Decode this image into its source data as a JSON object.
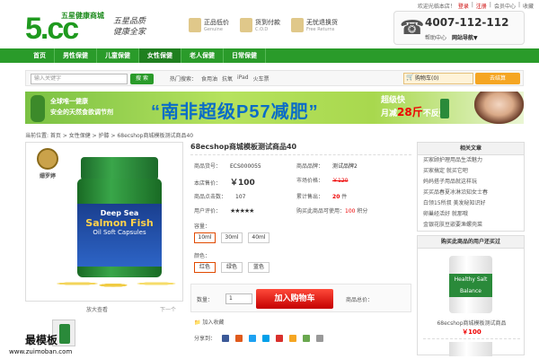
{
  "toplinks": {
    "welcome": "欢迎光临本店！",
    "login": "登录",
    "register": "注册",
    "member": "会员中心",
    "fav": "收藏"
  },
  "logo": {
    "top": "五星健康商城",
    "main": "5.cc",
    "slogan1": "五星品质",
    "slogan2": "健康全家"
  },
  "badges": [
    {
      "t1": "正品低价",
      "t2": "Genuine"
    },
    {
      "t1": "货到付款",
      "t2": "C.O.D"
    },
    {
      "t1": "无忧退换货",
      "t2": "Free Returns"
    }
  ],
  "hotline": {
    "number": "4007-112-112",
    "help": "帮助中心",
    "sitenav": "网站导航▼"
  },
  "nav": [
    "首页",
    "男性保健",
    "儿童保健",
    "女性保健",
    "老人保健",
    "日常保健"
  ],
  "nav_active": 3,
  "search": {
    "placeholder": "输入关键字",
    "button": "搜 索",
    "hot_label": "热门搜索：",
    "hot": [
      "食用油",
      "抗氧",
      "iPad",
      "火车票"
    ]
  },
  "cart": {
    "label": "购物车(0)",
    "checkout": "去结算"
  },
  "banner": {
    "left1": "全球唯一健康",
    "left2": "安全的天然食欲调节剂",
    "big": "“南非超级P57减肥”",
    "right1": "超级快",
    "right2pre": "月减",
    "right2num": "28斤",
    "right2post": "不反弹"
  },
  "breadcrumb": "当前位置: 首页 > 女性保健 > 护膝 > 68ecshop商城模板测试商品40",
  "image_panel": {
    "brand": "姗罗婷",
    "line1": "Deep Sea",
    "line2": "Salmon Fish",
    "line3": "Oil Soft Capsules",
    "zoom": "放大查看",
    "next": "下一个"
  },
  "watermark": {
    "cn": "最模板",
    "url": "www.zuimoban.com"
  },
  "product": {
    "title": "68ecshop商城模板测试商品40",
    "sku_label": "商品货号：",
    "sku": "ECS000055",
    "brand_label": "商品品牌：",
    "brand": "测试品牌2",
    "price_label": "本店售价：",
    "price": "￥100",
    "market_label": "市场价格：",
    "market": "￥120",
    "clicks_label": "商品点击数：",
    "clicks": "107",
    "sold_label": "累计售出：",
    "sold": "20",
    "sold_unit": "件",
    "rating_label": "用户评价：",
    "stars": "★★★★★",
    "points_label": "购买此商品可使用：",
    "points": "100",
    "points_unit": "积分",
    "capacity_label": "容量：",
    "capacities": [
      "10ml",
      "30ml",
      "40ml"
    ],
    "color_label": "颜色：",
    "colors": [
      "红色",
      "绿色",
      "蓝色"
    ],
    "qty_label": "数量：",
    "qty": "1",
    "buy_button": "加入购物车",
    "total_label": "商品总价：",
    "fav": "加入收藏",
    "share_label": "分享到："
  },
  "share_colors": [
    "#3b5998",
    "#e05a1c",
    "#1da1f2",
    "#00a0e9",
    "#d9302c",
    "#f5a623",
    "#6aa84f",
    "#999999"
  ],
  "sidebar": {
    "articles_title": "相关文章",
    "articles": [
      "买家顾护理用品生活魅力",
      "买家搞定 就买它吧",
      "妈妈搭子用品就这样玩",
      "买买品春夏冰淋沿知女士春",
      "白领15所叔 美发秘知识好",
      "卵巢经活好 就那哦",
      "金银花肤豆嵌要渔螺壳菜"
    ],
    "bought_title": "购买此商品的用户还买过",
    "bought_label": "Healthy Salt Balance",
    "bought_name": "68ecshop商城模板测试商品",
    "bought_price": "￥100"
  }
}
